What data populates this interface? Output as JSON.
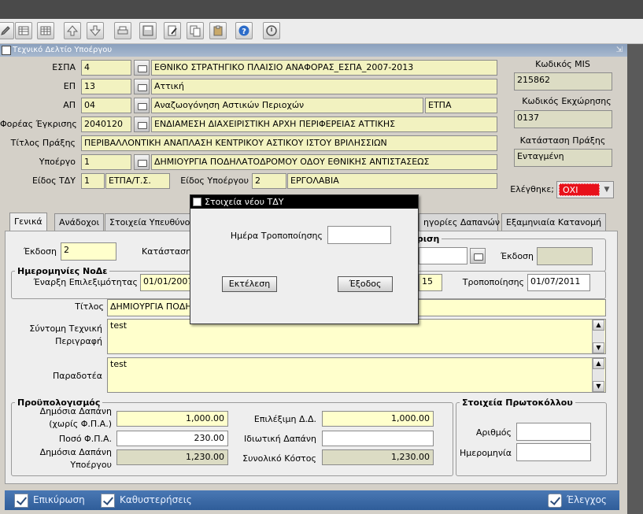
{
  "toolbar": {
    "icons": [
      "edit-icon",
      "add-record-icon",
      "grid-icon",
      "arrow-up-icon",
      "arrow-down-icon",
      "print-icon",
      "save-icon",
      "edit-document-icon",
      "copy-icon",
      "paste-icon",
      "help-icon",
      "info-icon"
    ]
  },
  "window": {
    "title": "Τεχνικό Δελτίο Υποέργου"
  },
  "header": {
    "espa_label": "ΕΣΠΑ",
    "espa_code": "4",
    "espa_name": "ΕΘΝΙΚΟ ΣΤΡΑΤΗΓΙΚΟ ΠΛΑΙΣΙΟ ΑΝΑΦΟΡΑΣ_ΕΣΠΑ_2007-2013",
    "ep_label": "ΕΠ",
    "ep_code": "13",
    "ep_name": "Αττική",
    "ap_label": "ΑΠ",
    "ap_code": "04",
    "ap_name": "Αναζωογόνηση Αστικών Περιοχών",
    "ap_type": "ΕΤΠΑ",
    "foreas_label": "Φορέας Έγκρισης",
    "foreas_code": "2040120",
    "foreas_name": "ΕΝΔΙΑΜΕΣΗ ΔΙΑΧΕΙΡΙΣΤΙΚΗ ΑΡΧΗ ΠΕΡΙΦΕΡΕΙΑΣ ΑΤΤΙΚΗΣ",
    "titlos_label": "Τίτλος Πράξης",
    "titlos_value": "ΠΕΡΙΒΑΛΛΟΝΤΙΚΗ ΑΝΑΠΛΑΣΗ ΚΕΝΤΡΙΚΟΥ ΑΣΤΙΚΟΥ ΙΣΤΟΥ ΒΡΙΛΗΣΣΙΩΝ",
    "ypoergo_label": "Υποέργο",
    "ypoergo_code": "1",
    "ypoergo_name": "ΔΗΜΙΟΥΡΓΙΑ ΠΟΔΗΛΑΤΟΔΡΟΜΟΥ ΟΔΟΥ ΕΘΝΙΚΗΣ ΑΝΤΙΣΤΑΣΕΩΣ",
    "eidos_tdy_label": "Είδος ΤΔΥ",
    "eidos_tdy_code": "1",
    "eidos_tdy_name": "ΕΤΠΑ/Τ.Σ.",
    "eidos_ypoergou_label": "Είδος Υποέργου",
    "eidos_ypoergou_code": "2",
    "eidos_ypoergou_name": "ΕΡΓΟΛΑΒΙΑ",
    "mis_label": "Κωδικός MIS",
    "mis_value": "215862",
    "kodikos_label": "Κωδικός Εκχώρησης",
    "kodikos_value": "0137",
    "katastasi_label": "Κατάσταση Πράξης",
    "katastasi_value": "Ενταγμένη",
    "elegxthike_label": "Ελέγθηκε;",
    "elegxthike_value": "ΟΧΙ"
  },
  "tabs": [
    {
      "label": "Γενικά"
    },
    {
      "label": "Ανάδοχοι"
    },
    {
      "label": "Στοιχεία Υπευθύνο"
    },
    {
      "label": "ηγορίες Δαπανών"
    },
    {
      "label": "Εξαμηνιαία Κατανομή"
    }
  ],
  "general": {
    "ekdosi_label": "Έκδοση",
    "ekdosi_value": "2",
    "katastasi_label": "Κατάσταση",
    "egkrisi_legend": "κριση",
    "egkrisi_ekdosi_label": "Έκδοση",
    "egkrisi_ekdosi_value": "",
    "dates_legend": "Ημερομηνίες ΝοΔε",
    "enarxi_label": "Έναρξη Επιλεξιμότητας",
    "enarxi_value": "01/01/2007",
    "lixi_value": "15",
    "tropopoiisis_label": "Τροποποίησης",
    "tropopoiisis_value": "01/07/2011",
    "titlos_label": "Τίτλος",
    "titlos_value": "ΔΗΜΙΟΥΡΓΙΑ ΠΟΔΗ",
    "perigrafi_label_1": "Σύντομη Τεχνική",
    "perigrafi_label_2": "Περιγραφή",
    "perigrafi_value": "test",
    "paradotea_label": "Παραδοτέα",
    "paradotea_value": "test"
  },
  "budget": {
    "legend": "Προϋπολογισμός",
    "dimosia_label_1": "Δημόσια Δαπάνη",
    "dimosia_label_2": "(χωρίς Φ.Π.Α.)",
    "dimosia_value": "1,000.00",
    "fpa_label": "Ποσό Φ.Π.Α.",
    "fpa_value": "230.00",
    "ypoergou_label_1": "Δημόσια Δαπάνη",
    "ypoergou_label_2": "Υποέργου",
    "ypoergou_value": "1,230.00",
    "epileximi_label": "Επιλέξιμη Δ.Δ.",
    "epileximi_value": "1,000.00",
    "idiotiki_label": "Ιδιωτική Δαπάνη",
    "idiotiki_value": "",
    "synoliko_label": "Συνολικό Κόστος",
    "synoliko_value": "1,230.00"
  },
  "protocol": {
    "legend": "Στοιχεία Πρωτοκόλλου",
    "arithmos_label": "Αριθμός",
    "arithmos_value": "",
    "imerominia_label": "Ημερομηνία",
    "imerominia_value": ""
  },
  "dialog": {
    "title": "Στοιχεία νέου ΤΔΥ",
    "date_label": "Ημέρα Τροποποίησης",
    "date_value": "",
    "execute_label": "Εκτέλεση",
    "exit_label": "Έξοδος"
  },
  "statusbar": {
    "confirm_label": "Επικύρωση",
    "delays_label": "Καθυστερήσεις",
    "check_label": "Έλεγχος"
  },
  "colors": {
    "status_bg": "#3a6aa8",
    "warning": "#e8101a"
  }
}
